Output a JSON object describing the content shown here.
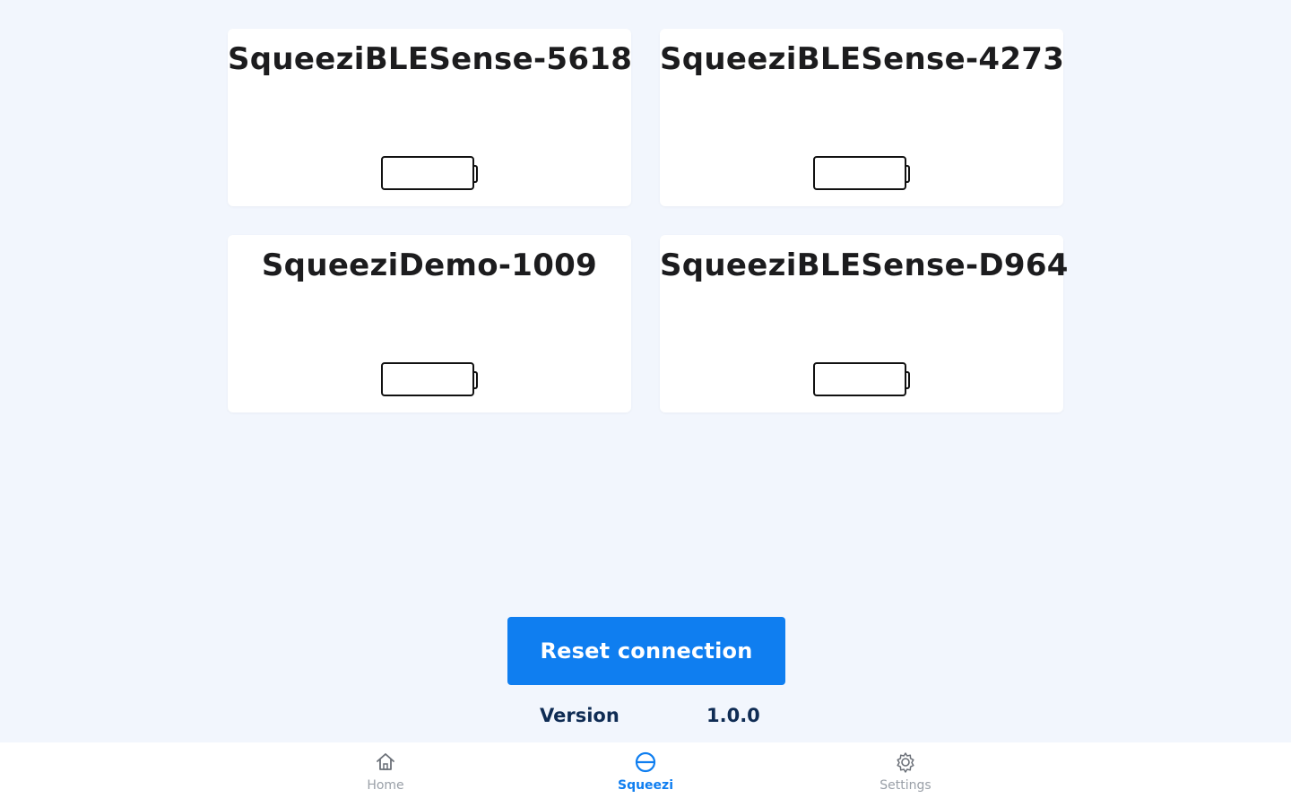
{
  "devices": [
    {
      "name": "SqueeziBLESense-5618"
    },
    {
      "name": "SqueeziBLESense-4273"
    },
    {
      "name": "SqueeziDemo-1009"
    },
    {
      "name": "SqueeziBLESense-D964"
    }
  ],
  "actions": {
    "reset_label": "Reset connection"
  },
  "version": {
    "label": "Version",
    "value": "1.0.0"
  },
  "nav": {
    "active": "squeezi",
    "items": [
      {
        "id": "home",
        "label": "Home",
        "icon": "home-icon"
      },
      {
        "id": "squeezi",
        "label": "Squeezi",
        "icon": "squeezi-icon"
      },
      {
        "id": "settings",
        "label": "Settings",
        "icon": "gear-icon"
      }
    ]
  },
  "colors": {
    "background": "#f2f6fd",
    "accent": "#0f7ef0",
    "card": "#ffffff",
    "version_text": "#0f2c54",
    "nav_inactive": "#9aa0a8"
  }
}
